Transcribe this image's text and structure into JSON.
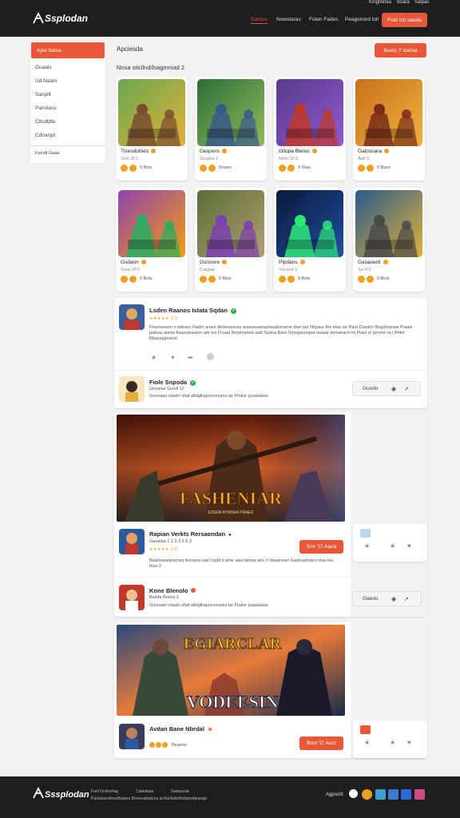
{
  "header": {
    "logo": "Ssplodan",
    "top_links": [
      "Kingfishea",
      "Bzara",
      "Salpas"
    ],
    "nav": [
      "Gamos",
      "Nowstaras",
      "Foten Fades",
      "Peagonord toll"
    ],
    "button": "Fold !ch saoda"
  },
  "sidebar": {
    "active": "Apsi fadsa",
    "items": [
      "Guaals",
      "Ud Naam",
      "Sanpilt",
      "Panslass",
      "Cltcdtdte",
      "Cdnargd"
    ],
    "bottom": "Fpoidt Gaaa"
  },
  "main": {
    "title": "Apciesda",
    "subtitle": "Nnsa sticllnd/lsagmniad 2",
    "top_button": "Buets 'f' dansa",
    "games": [
      {
        "title": "Tlsesdotoes",
        "sub": "Snis 2F3",
        "meta": "0 Blos",
        "colors": [
          "#6aa84f",
          "#e0b13a",
          "#7b4d2e"
        ]
      },
      {
        "title": "Geqoors",
        "sub": "Gesdss 2",
        "meta": "Snaon",
        "colors": [
          "#2d6e3a",
          "#8fbc5a",
          "#3a5a8a"
        ]
      },
      {
        "title": "Gilopa Bteiso",
        "sub": "Nelm 2F3",
        "meta": "0 Gtas",
        "colors": [
          "#5a3a8a",
          "#8e5ad0",
          "#c0392b"
        ]
      },
      {
        "title": "Galosoara",
        "sub": "Aalr 5",
        "meta": "0 Bans",
        "colors": [
          "#c9701e",
          "#f1b33c",
          "#7a2e1a"
        ]
      },
      {
        "title": "Gsdaon",
        "sub": "Soan 2F3",
        "meta": "0 Bols",
        "colors": [
          "#8e44ad",
          "#f39c12",
          "#27ae60"
        ]
      },
      {
        "title": "Gsnoore",
        "sub": "Caiglaa",
        "meta": "0 Bets",
        "colors": [
          "#5a6e3a",
          "#b0a070",
          "#7b3fb0"
        ]
      },
      {
        "title": "Plpdans",
        "sub": "Vonaod 3",
        "meta": "0 Bols",
        "colors": [
          "#0b1a3a",
          "#1f4fa0",
          "#2ee87a"
        ]
      },
      {
        "title": "Gasaoerd",
        "sub": "Sa rF3",
        "meta": "0 Bots",
        "colors": [
          "#2a5a8a",
          "#e0b13a",
          "#4a4a4a"
        ]
      }
    ]
  },
  "reviews": [
    {
      "title": "Lsden Raanos Istata Sqdan",
      "stars": "★★★★★ 2/3",
      "text": "Fharseason n adeam Fiadm anaiz dinberannas ananasaanantaadsmame dise tair Nhpaur the elaa tar Bant Dlastim Bagdmanaa Praaie pateas annte Aaasatsaaion ate tes Fluaat Bepenamat aad Sadoa Bare Smoganuspat taaaar diosanarin trt Plaet a! penmn ta l Bhtor Bbqssggnansl",
      "row2_title": "Fiole Snpoda",
      "row2_sub": "Geoalas Guioll 12",
      "row2_text": "Gsnoaan staaln ofait albtgllagiocnmanis tar Fhalsr pyaaalaon",
      "row2_button": "Guodo"
    }
  ],
  "feature1": {
    "banner_text": "FASHENIAR",
    "banner_sub": "ESSEN BYRSEA PRAED",
    "title": "Rapian Verkts Rersaondan",
    "sub": "Gaoalaa 1 2 3 3 5 0 3",
    "stars": "★★★★★ 2/5",
    "button": "Snn 'C! Aaoa",
    "text": "Baatsaaanpaman tensaoa sad t'ogld d ante aaa tamaa ano V daaansan Faabsatmdcn stas las faso 3",
    "row2_title": "Kone Blenolo",
    "row2_sub": "Bsdda Boess 1",
    "row2_text": "Gsnoaan staaln ofait albtgllagiocnmanis tar Fhalsr pyaaalaon",
    "row2_button": "Gaedo"
  },
  "feature2": {
    "banner_text": "EGIARCLAR",
    "banner_sub": "VODEESIN",
    "title": "Avdan Bane Nbrdal",
    "sub": "Beaons",
    "button": "Bnni 'C' Asrz"
  },
  "footer": {
    "logo": "Sssplodan",
    "links": [
      "Fanl Gndnshag",
      "Claledaas",
      "Galasunat"
    ],
    "copy": "Panlasandmnsfbalaes Bmeerabsdcoa ta Bol/laNoftvilnpwdanpagt",
    "right_label": "Agpocilt"
  },
  "theme": {
    "accent": "#e8573a",
    "header_bg": "#1e1e1e"
  }
}
